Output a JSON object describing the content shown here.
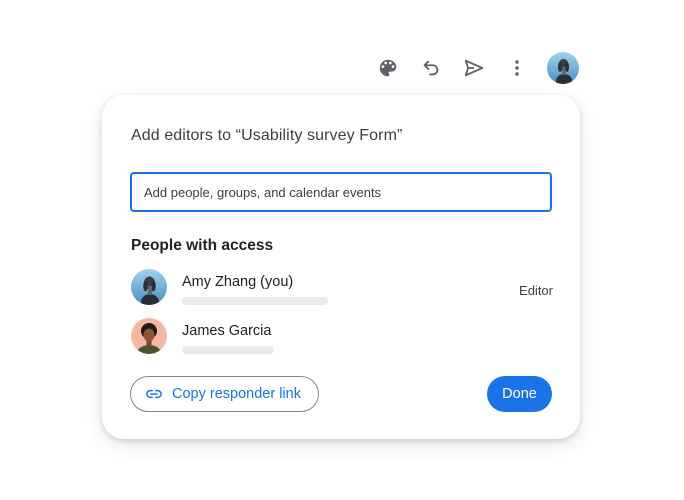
{
  "toolbar": {
    "icons": [
      "palette-icon",
      "undo-icon",
      "send-icon",
      "more-vert-icon"
    ],
    "icon_color": "#5f6368"
  },
  "dialog": {
    "title": "Add editors to “Usability survey Form”",
    "search": {
      "value": "",
      "placeholder": "Add people, groups, and calendar events"
    },
    "section_title": "People with access",
    "people": [
      {
        "name": "Amy Zhang (you)",
        "role": "Editor"
      },
      {
        "name": "James Garcia",
        "role": ""
      }
    ],
    "copy_link_label": "Copy responder link",
    "done_label": "Done"
  },
  "colors": {
    "accent": "#1a73e8",
    "text_primary": "#202124",
    "text_secondary": "#3c4043",
    "placeholder_bar": "#e8eaed"
  }
}
